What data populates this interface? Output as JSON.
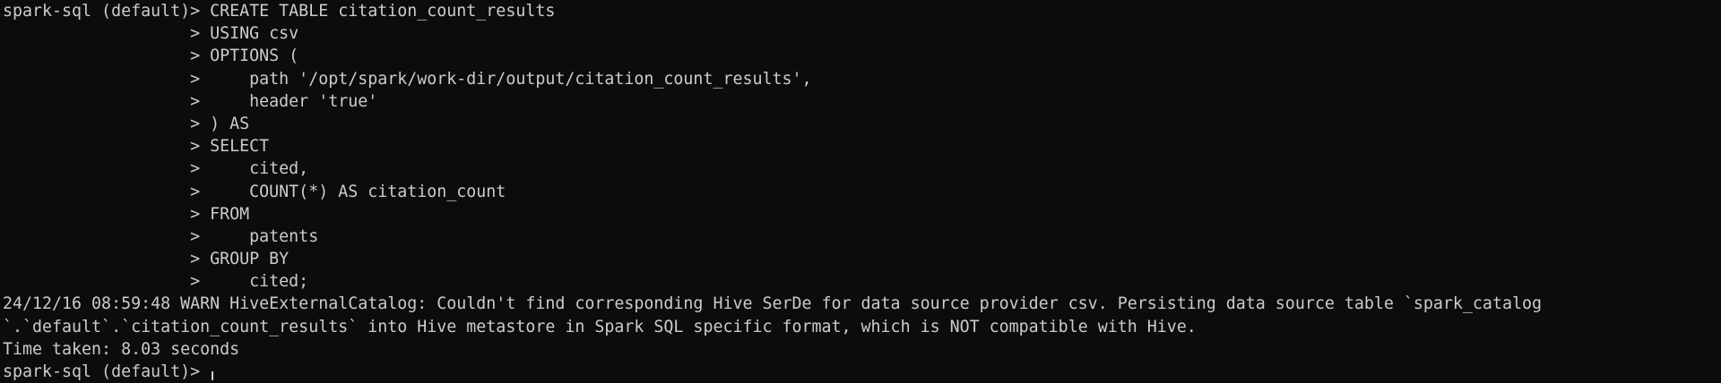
{
  "terminal": {
    "lines": [
      "spark-sql (default)> CREATE TABLE citation_count_results",
      "                   > USING csv",
      "                   > OPTIONS (",
      "                   >     path '/opt/spark/work-dir/output/citation_count_results',",
      "                   >     header 'true'",
      "                   > ) AS",
      "                   > SELECT",
      "                   >     cited,",
      "                   >     COUNT(*) AS citation_count",
      "                   > FROM",
      "                   >     patents",
      "                   > GROUP BY",
      "                   >     cited;",
      "24/12/16 08:59:48 WARN HiveExternalCatalog: Couldn't find corresponding Hive SerDe for data source provider csv. Persisting data source table `spark_catalog",
      "`.`default`.`citation_count_results` into Hive metastore in Spark SQL specific format, which is NOT compatible with Hive.",
      "Time taken: 8.03 seconds"
    ],
    "prompt": "spark-sql (default)> "
  }
}
